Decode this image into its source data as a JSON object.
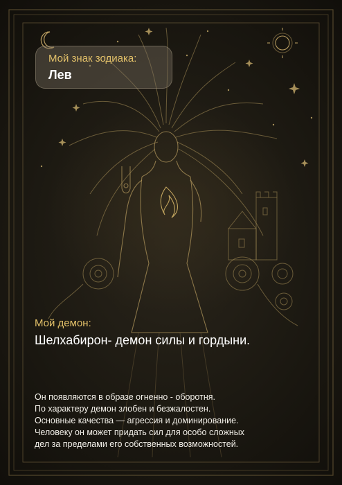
{
  "zodiac": {
    "label": "Мой знак зодиака:",
    "value": "Лев"
  },
  "demon": {
    "label": "Мой демон:",
    "name": "Шелхабирон- демон силы и гордыни."
  },
  "description": {
    "lines": [
      "Он появляются в образе огненно - оборотня.",
      "По характеру демон злобен и безжалостен.",
      "Основные качества — агрессия и доминирование.",
      "Человеку он может придать сил для особо сложных",
      "дел за пределами его собственных возможностей."
    ]
  },
  "colors": {
    "accent": "#e2c069",
    "text": "#ffffff",
    "background": "#1b1811",
    "line_art": "#8a7448"
  },
  "icons": [
    "crescent-moon-icon",
    "sun-icon",
    "star-icon"
  ]
}
